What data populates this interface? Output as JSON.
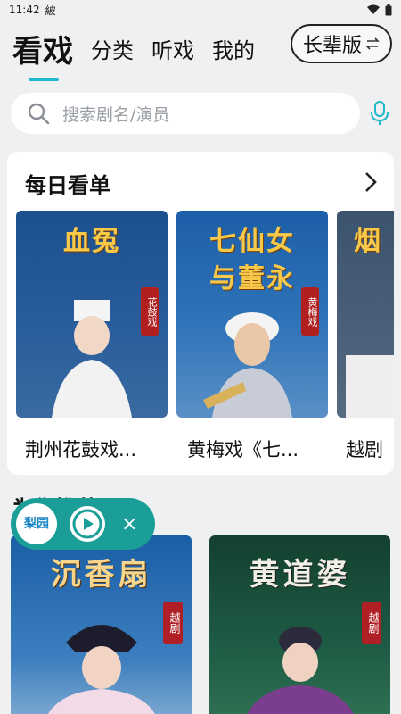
{
  "status": {
    "time": "11:42",
    "extra": "紴"
  },
  "tabs": [
    {
      "label": "看戏",
      "active": true
    },
    {
      "label": "分类"
    },
    {
      "label": "听戏"
    },
    {
      "label": "我的"
    }
  ],
  "elder_mode": {
    "label": "长辈版",
    "icon": "swap-arrows-icon"
  },
  "search": {
    "placeholder": "搜索剧名/演员",
    "icon": "search-icon",
    "voice_icon": "microphone-icon"
  },
  "daily": {
    "title": "每日看单",
    "items": [
      {
        "poster_title": "血冤",
        "seal": "花鼓戏",
        "caption": "荆州花鼓戏..."
      },
      {
        "poster_title_line1": "七仙女",
        "poster_title_line2": "与董永",
        "seal": "黄梅戏",
        "caption": "黄梅戏《七..."
      },
      {
        "poster_title": "烟",
        "caption": "越剧"
      }
    ]
  },
  "player": {
    "logo_text": "梨园",
    "play_icon": "play-icon",
    "close_label": "×"
  },
  "recommend": {
    "title": "为你推荐",
    "items": [
      {
        "poster_title": "沉香扇",
        "seal": "越剧"
      },
      {
        "poster_title": "黄道婆",
        "seal": "越剧"
      }
    ]
  },
  "colors": {
    "accent": "#1fb8c8",
    "player": "#1b9e97",
    "seal": "#b1201e"
  }
}
